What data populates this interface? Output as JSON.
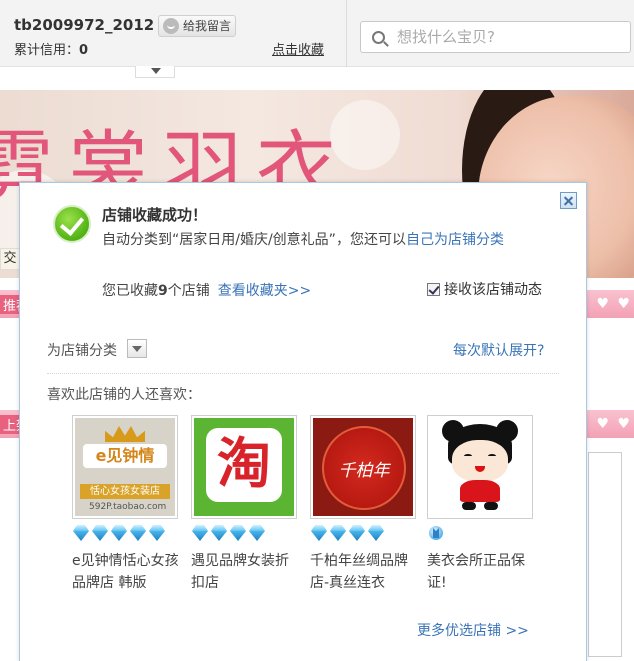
{
  "header": {
    "seller_name": "tb2009972_2012",
    "message_button": "给我留言",
    "credit_label": "累计信用：",
    "credit_value": "0",
    "favorite_link": "点击收藏",
    "search_placeholder": "想找什么宝贝?"
  },
  "banner": {
    "title": "霓裳羽衣"
  },
  "background": {
    "side_tag": "交",
    "strip_1_label": "推荐",
    "strip_2_label": "上架"
  },
  "modal": {
    "title": "店铺收藏成功！",
    "desc_prefix": "自动分类到",
    "category": "“居家日用/婚庆/创意礼品”",
    "desc_mid": "，您还可以",
    "classify_link": "自己为店铺分类",
    "count_prefix": "您已收藏",
    "count": "9",
    "count_suffix": "个店铺",
    "view_favorites_link": "查看收藏夹>>",
    "subscribe_label": "接收该店铺动态",
    "subscribe_checked": true,
    "category_label": "为店铺分类",
    "expand_link": "每次默认展开?",
    "recommend_title": "喜欢此店铺的人还喜欢：",
    "shops": [
      {
        "name": "e见钟情恬心女孩品牌店 韩版",
        "thumb_logo": "e见钟情",
        "thumb_tag": "恬心女孩女装店",
        "thumb_url": "592P.taobao.com",
        "rating_icon": "diamond-icon",
        "rating_level": 5
      },
      {
        "name": "遇见品牌女装折扣店",
        "thumb_logo": "淘",
        "rating_icon": "diamond-icon",
        "rating_level": 4
      },
      {
        "name": "千柏年丝绸品牌店-真丝连衣",
        "thumb_logo": "千柏年",
        "rating_icon": "diamond-icon",
        "rating_level": 4
      },
      {
        "name": "美衣会所正品保证!",
        "rating_icon": "crown-icon",
        "rating_level": 1
      }
    ],
    "more_shops_link": "更多优选店铺 >>"
  },
  "colors": {
    "link": "#3a74b7",
    "success_green": "#56b618",
    "modal_border": "#a9c8e5",
    "banner_pink": "#e1567a"
  }
}
